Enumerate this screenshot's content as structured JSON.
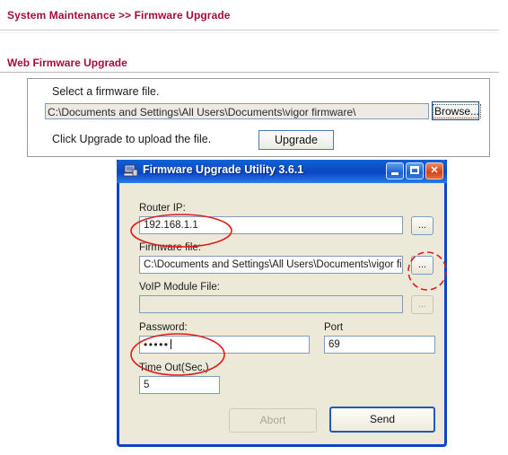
{
  "webpage": {
    "breadcrumb": "System Maintenance >> Firmware Upgrade",
    "section_title": "Web Firmware Upgrade",
    "select_label": "Select a firmware file.",
    "file_path": "C:\\Documents and Settings\\All Users\\Documents\\vigor firmware\\",
    "browse_label": "Browse...",
    "click_label": "Click Upgrade to upload the file.",
    "upgrade_label": "Upgrade",
    "accent_color": "#a40c3f"
  },
  "dialog": {
    "title": "Firmware Upgrade Utility 3.6.1",
    "icon": "computer-icon",
    "window_buttons": {
      "minimize": "minimize-button",
      "maximize": "maximize-button",
      "close": "close-button"
    },
    "fields": {
      "router_ip": {
        "label": "Router IP:",
        "value": "192.168.1.1",
        "browse_label": "...",
        "browse_enabled": true
      },
      "firmware_file": {
        "label": "Firmware file:",
        "value": "C:\\Documents and Settings\\All Users\\Documents\\vigor firmw",
        "browse_label": "...",
        "browse_enabled": true
      },
      "voip_module_file": {
        "label": "VoIP Module File:",
        "value": "",
        "browse_label": "...",
        "browse_enabled": false
      },
      "password": {
        "label": "Password:",
        "value": "•••••",
        "masked": true
      },
      "port": {
        "label": "Port",
        "value": "69"
      },
      "timeout": {
        "label": "Time Out(Sec.)",
        "value": "5"
      }
    },
    "buttons": {
      "abort": "Abort",
      "abort_enabled": false,
      "send": "Send",
      "send_enabled": true
    },
    "titlebar_color": "#0a4bc0",
    "body_color": "#ece9d8"
  },
  "annotations": {
    "color": "#e01b1b",
    "items": [
      "router-ip-value-highlight",
      "firmware-browse-button-highlight",
      "password-field-highlight"
    ]
  }
}
